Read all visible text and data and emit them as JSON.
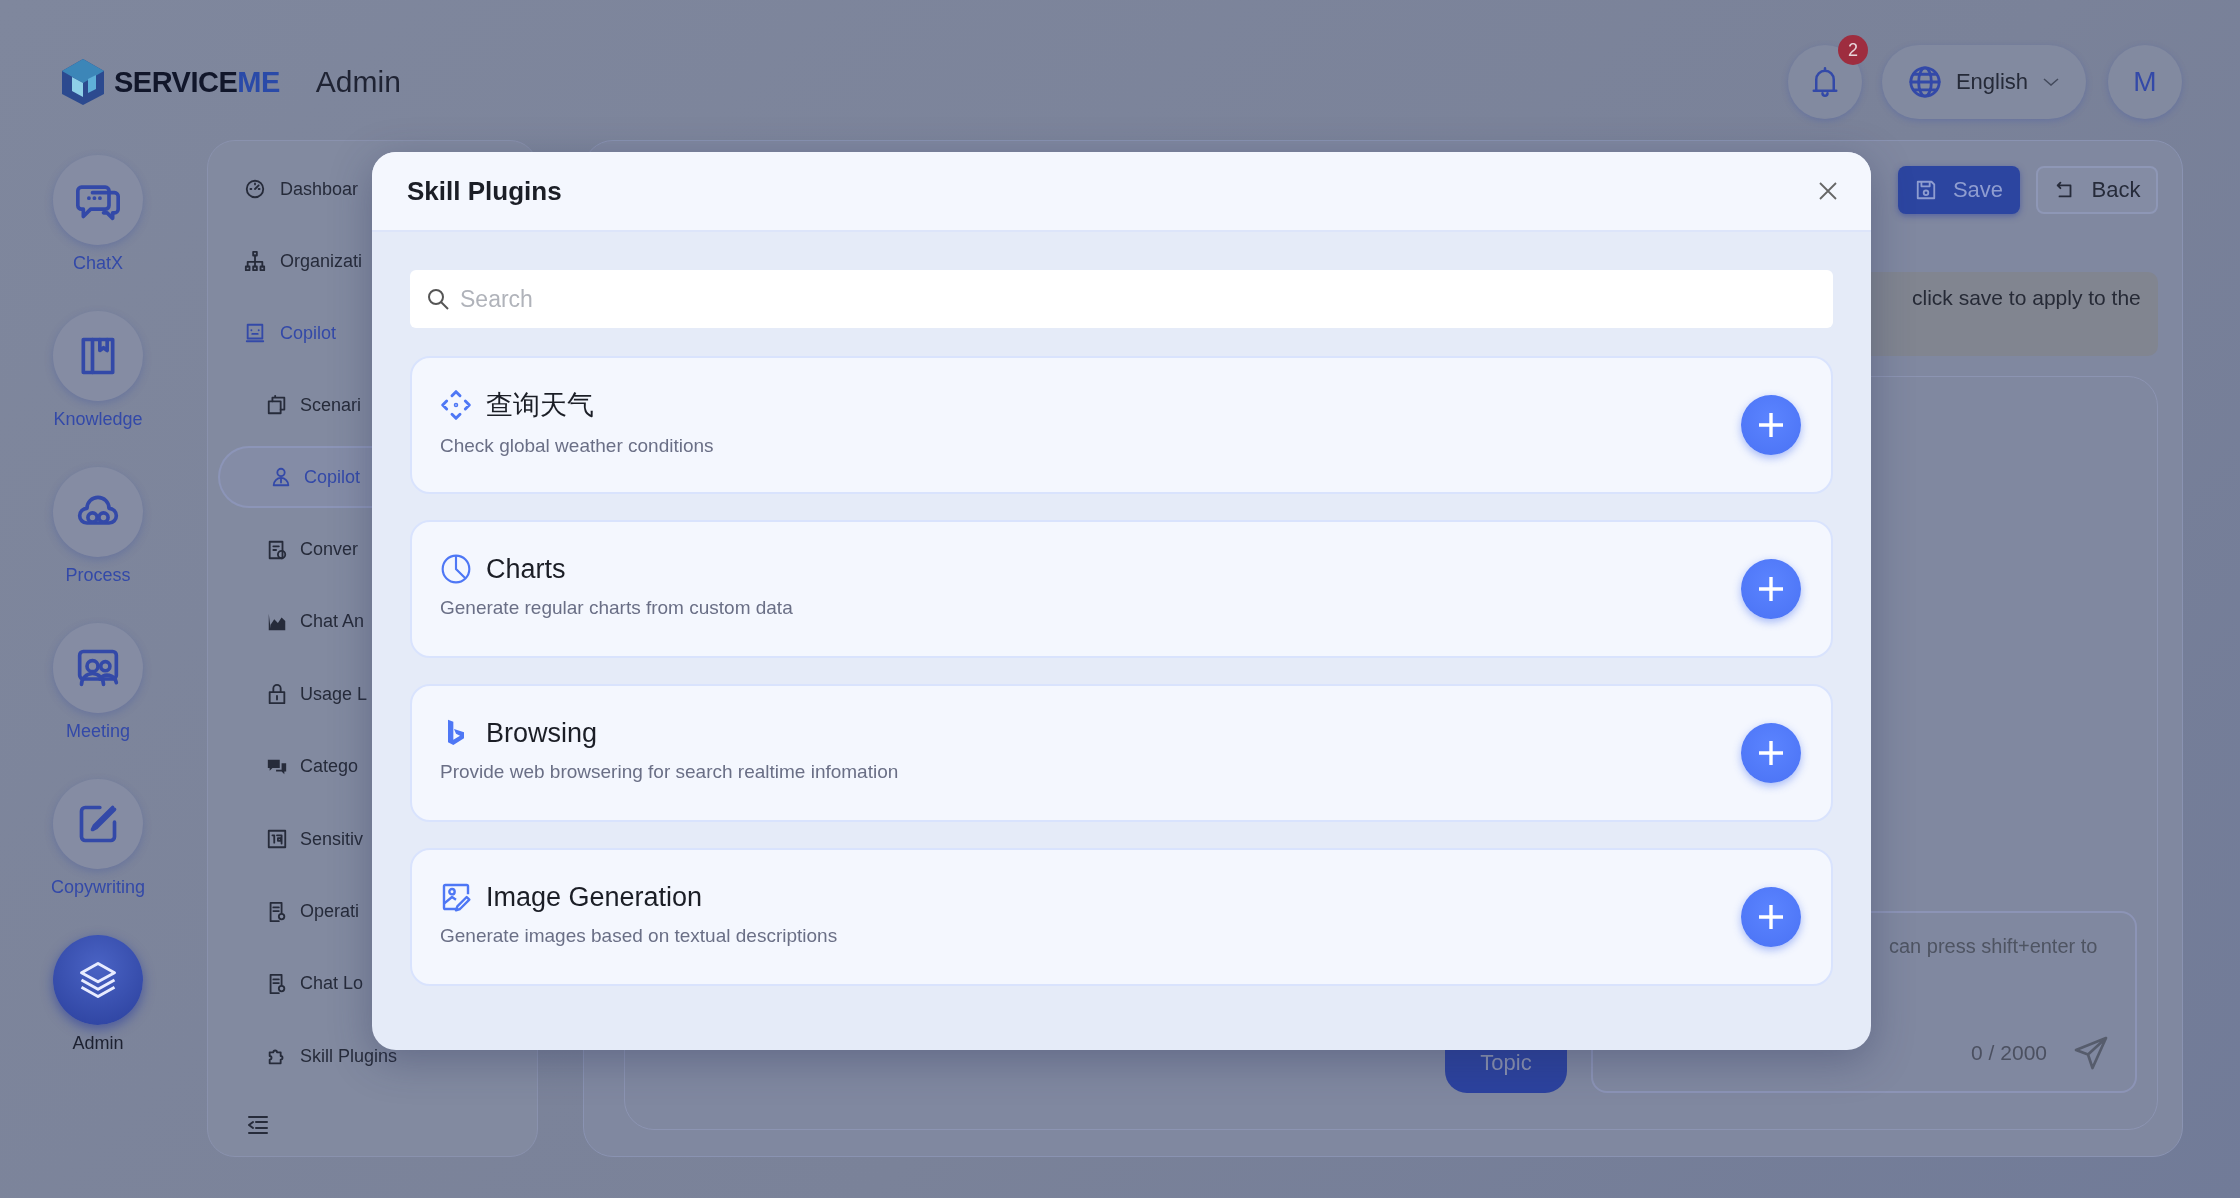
{
  "header": {
    "brand": [
      "SERVICE",
      "ME"
    ],
    "title": "Admin",
    "notifications": "2",
    "language": "English",
    "avatar": "M"
  },
  "rail": [
    {
      "label": "ChatX",
      "kind": "chat",
      "selected": false
    },
    {
      "label": "Knowledge",
      "kind": "book",
      "selected": false
    },
    {
      "label": "Process",
      "kind": "cloud",
      "selected": false
    },
    {
      "label": "Meeting",
      "kind": "people",
      "selected": false
    },
    {
      "label": "Copywriting",
      "kind": "edit",
      "selected": false
    },
    {
      "label": "Admin",
      "kind": "layers",
      "selected": true
    }
  ],
  "sidebar": {
    "items": [
      {
        "label": "Dashboar",
        "kind": "gauge",
        "selected": false
      },
      {
        "label": "Organizati",
        "kind": "org",
        "selected": false
      },
      {
        "label": "Copilot",
        "kind": "bot",
        "selected": false,
        "expanded": true,
        "children": [
          {
            "label": "Scenari",
            "kind": "copy",
            "selected": false
          },
          {
            "label": "Copilot",
            "kind": "user",
            "selected": true
          },
          {
            "label": "Conver",
            "kind": "clipboard",
            "selected": false
          },
          {
            "label": "Chat An",
            "kind": "area",
            "selected": false
          },
          {
            "label": "Usage L",
            "kind": "lock",
            "selected": false
          },
          {
            "label": "Catego",
            "kind": "chats",
            "selected": false
          },
          {
            "label": "Sensitiv",
            "kind": "word",
            "selected": false
          },
          {
            "label": "Operati",
            "kind": "doc",
            "selected": false
          },
          {
            "label": "Chat Lo",
            "kind": "doc",
            "selected": false
          },
          {
            "label": "Skill Plugins",
            "kind": "puzzle",
            "selected": false
          }
        ]
      }
    ]
  },
  "main": {
    "buttons": [
      {
        "label": "Save",
        "kind": "save"
      },
      {
        "label": "Back",
        "kind": "back"
      }
    ],
    "notice": "click save to apply to the",
    "input": {
      "placeholder": "can press shift+enter to"
    },
    "counter": "0 / 2000",
    "topic_button": "Topic"
  },
  "modal": {
    "title": "Skill Plugins",
    "search": {
      "placeholder": "Search"
    },
    "plugins": [
      {
        "name": "查询天气",
        "description": "Check global weather conditions",
        "kind": "weather"
      },
      {
        "name": "Charts",
        "description": "Generate regular charts from custom data",
        "kind": "chart"
      },
      {
        "name": "Browsing",
        "description": "Provide web browsering for search realtime infomation",
        "kind": "bing"
      },
      {
        "name": "Image Generation",
        "description": "Generate images based on textual descriptions",
        "kind": "image"
      }
    ]
  }
}
